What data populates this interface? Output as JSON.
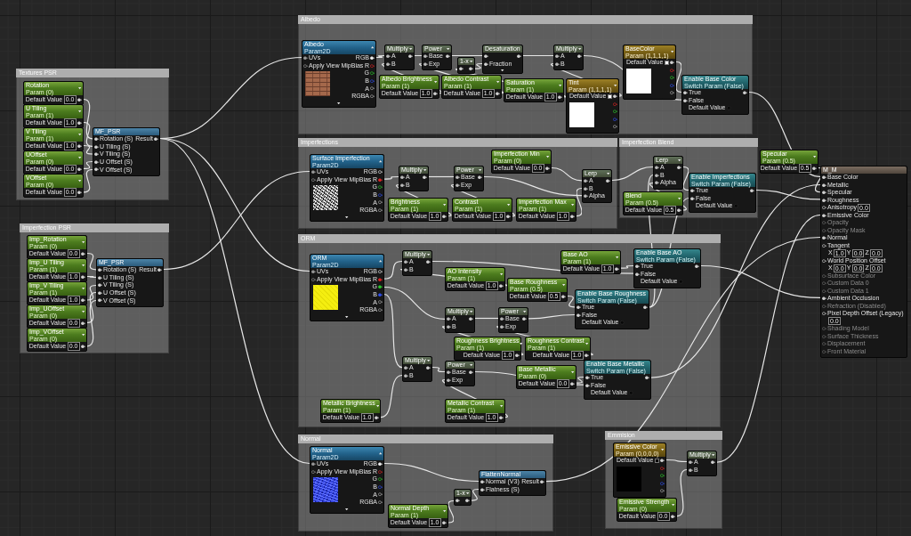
{
  "comment_boxes": [
    {
      "title": "Albedo",
      "nodes": [
        {
          "kind": "texture",
          "title": "Albedo",
          "subtitle": "Param2D",
          "inputs": [
            "UVs",
            "Apply View MipBias"
          ],
          "outputs": [
            "RGB",
            "R",
            "G",
            "B",
            "A",
            "RGBA"
          ]
        },
        {
          "kind": "math",
          "title": "Multiply",
          "inputs": [
            "A",
            "B"
          ]
        },
        {
          "kind": "scalar_param",
          "title": "Albedo Brightness",
          "subtitle": "Param (1)",
          "label": "Default Value",
          "value": "1.0"
        },
        {
          "kind": "math",
          "title": "Power",
          "inputs": [
            "Base",
            "Exp"
          ]
        },
        {
          "kind": "scalar_param",
          "title": "Albedo Contrast",
          "subtitle": "Param (1)",
          "label": "Default Value",
          "value": "1.0"
        },
        {
          "kind": "one_minus",
          "title": "1-x"
        },
        {
          "kind": "desaturation",
          "title": "Desaturation",
          "inputs": [
            "Fraction"
          ]
        },
        {
          "kind": "scalar_param",
          "title": "Saturation",
          "subtitle": "Param (1)",
          "label": "Default Value",
          "value": "1.0"
        },
        {
          "kind": "math",
          "title": "Multiply",
          "inputs": [
            "A",
            "B"
          ]
        },
        {
          "kind": "vector_param",
          "title": "Tint",
          "subtitle": "Param (1,1,1,1)",
          "label": "Default Value",
          "color": "#ffffff"
        },
        {
          "kind": "vector_param",
          "title": "BaseColor",
          "subtitle": "Param (1,1,1,1)",
          "label": "Default Value",
          "color": "#ffffff"
        },
        {
          "kind": "switch",
          "title": "Enable Base Color",
          "subtitle": "Switch Param (False)",
          "inputs": [
            "True",
            "False"
          ],
          "label": "Default Value",
          "checked": false
        }
      ]
    },
    {
      "title": "Textures PSR",
      "nodes": [
        {
          "kind": "scalar_param",
          "title": "Rotation",
          "subtitle": "Param (0)",
          "label": "Default Value",
          "value": "0.0"
        },
        {
          "kind": "scalar_param",
          "title": "U Tiling",
          "subtitle": "Param (1)",
          "label": "Default Value",
          "value": "1.0"
        },
        {
          "kind": "scalar_param",
          "title": "V Tiling",
          "subtitle": "Param (1)",
          "label": "Default Value",
          "value": "1.0"
        },
        {
          "kind": "scalar_param",
          "title": "UOffset",
          "subtitle": "Param (0)",
          "label": "Default Value",
          "value": "0.0"
        },
        {
          "kind": "scalar_param",
          "title": "VOffset",
          "subtitle": "Param (0)",
          "label": "Default Value",
          "value": "0.0"
        },
        {
          "kind": "function",
          "title": "MF_PSR",
          "inputs": [
            "Rotation (S)",
            "U Tiling (S)",
            "V Tiling (S)",
            "U Offset (S)",
            "V Offset (S)"
          ],
          "outputs": [
            "Result"
          ]
        }
      ]
    },
    {
      "title": "Imperfections",
      "nodes": [
        {
          "kind": "texture",
          "title": "Surface Imperfection",
          "subtitle": "Param2D",
          "inputs": [
            "UVs",
            "Apply View MipBias"
          ],
          "outputs": [
            "RGB",
            "R",
            "G",
            "B",
            "A",
            "RGBA"
          ]
        },
        {
          "kind": "math",
          "title": "Multiply",
          "inputs": [
            "A",
            "B"
          ]
        },
        {
          "kind": "scalar_param",
          "title": "Brightness",
          "subtitle": "Param (1)",
          "label": "Default Value",
          "value": "1.0"
        },
        {
          "kind": "math",
          "title": "Power",
          "inputs": [
            "Base",
            "Exp"
          ]
        },
        {
          "kind": "scalar_param",
          "title": "Contrast",
          "subtitle": "Param (1)",
          "label": "Default Value",
          "value": "1.0"
        },
        {
          "kind": "scalar_param",
          "title": "Imperfection Min",
          "subtitle": "Param (0)",
          "label": "Default Value",
          "value": "0.0"
        },
        {
          "kind": "scalar_param",
          "title": "Imperfection Max",
          "subtitle": "Param (1)",
          "label": "Default Value",
          "value": "1.0"
        },
        {
          "kind": "math",
          "title": "Lerp",
          "inputs": [
            "A",
            "B",
            "Alpha"
          ]
        }
      ]
    },
    {
      "title": "Imperfection Blend",
      "nodes": [
        {
          "kind": "math",
          "title": "Lerp",
          "inputs": [
            "A",
            "B",
            "Alpha"
          ]
        },
        {
          "kind": "scalar_param",
          "title": "Blend",
          "subtitle": "Param (0.5)",
          "label": "Default Value",
          "value": "0.5"
        },
        {
          "kind": "switch",
          "title": "Enable Imperfections",
          "subtitle": "Switch Param (False)",
          "inputs": [
            "True",
            "False"
          ],
          "label": "Default Value",
          "checked": false
        }
      ]
    },
    {
      "title": "Imperfection PSR",
      "nodes": [
        {
          "kind": "scalar_param",
          "title": "Imp_Rotation",
          "subtitle": "Param (0)",
          "label": "Default Value",
          "value": "0.0"
        },
        {
          "kind": "scalar_param",
          "title": "Imp_U Tiling",
          "subtitle": "Param (1)",
          "label": "Default Value",
          "value": "1.0"
        },
        {
          "kind": "scalar_param",
          "title": "Imp_V Tiling",
          "subtitle": "Param (1)",
          "label": "Default Value",
          "value": "1.0"
        },
        {
          "kind": "scalar_param",
          "title": "Imp_UOffset",
          "subtitle": "Param (0)",
          "label": "Default Value",
          "value": "0.0"
        },
        {
          "kind": "scalar_param",
          "title": "Imp_VOffset",
          "subtitle": "Param (0)",
          "label": "Default Value",
          "value": "0.0"
        },
        {
          "kind": "function",
          "title": "MF_PSR",
          "inputs": [
            "Rotation (S)",
            "U Tiling (S)",
            "V Tiling (S)",
            "U Offset (S)",
            "V Offset (S)"
          ],
          "outputs": [
            "Result"
          ]
        }
      ]
    },
    {
      "title": "ORM",
      "nodes": [
        {
          "kind": "texture",
          "title": "ORM",
          "subtitle": "Param2D",
          "inputs": [
            "UVs",
            "Apply View MipBias"
          ],
          "outputs": [
            "RGB",
            "R",
            "G",
            "B",
            "A",
            "RGBA"
          ]
        },
        {
          "kind": "math",
          "title": "Multiply",
          "inputs": [
            "A",
            "B"
          ]
        },
        {
          "kind": "scalar_param",
          "title": "AO Intensity",
          "subtitle": "Param (1)",
          "label": "Default Value",
          "value": "1.0"
        },
        {
          "kind": "scalar_param",
          "title": "Base Roughness",
          "subtitle": "Param (0.5)",
          "label": "Default Value",
          "value": "0.5"
        },
        {
          "kind": "scalar_param",
          "title": "Base AO",
          "subtitle": "Param (1)",
          "label": "Default Value",
          "value": "1.0"
        },
        {
          "kind": "switch",
          "title": "Enable Base AO",
          "subtitle": "Switch Param (False)",
          "inputs": [
            "True",
            "False"
          ],
          "label": "Default Value",
          "checked": false
        },
        {
          "kind": "math",
          "title": "Multiply",
          "inputs": [
            "A",
            "B"
          ]
        },
        {
          "kind": "math",
          "title": "Power",
          "inputs": [
            "Base",
            "Exp"
          ]
        },
        {
          "kind": "switch",
          "title": "Enable Base Roughness",
          "subtitle": "Switch Param (False)",
          "inputs": [
            "True",
            "False"
          ],
          "label": "Default Value",
          "checked": false
        },
        {
          "kind": "scalar_param",
          "title": "Roughness Brightness",
          "subtitle": "Param (1)",
          "label": "Default Value",
          "value": "1.0"
        },
        {
          "kind": "scalar_param",
          "title": "Roughness Contrast",
          "subtitle": "Param (1)",
          "label": "Default Value",
          "value": "1.0"
        },
        {
          "kind": "math",
          "title": "Multiply",
          "inputs": [
            "A",
            "B"
          ]
        },
        {
          "kind": "math",
          "title": "Power",
          "inputs": [
            "Base",
            "Exp"
          ]
        },
        {
          "kind": "scalar_param",
          "title": "Base Metallic",
          "subtitle": "Param (0)",
          "label": "Default Value",
          "value": "0.0"
        },
        {
          "kind": "switch",
          "title": "Enable Base Metallic",
          "subtitle": "Switch Param (False)",
          "inputs": [
            "True",
            "False"
          ],
          "label": "Default Value",
          "checked": false
        },
        {
          "kind": "scalar_param",
          "title": "Metallic Brightness",
          "subtitle": "Param (1)",
          "label": "Default Value",
          "value": "1.0"
        },
        {
          "kind": "scalar_param",
          "title": "Metallic Contrast",
          "subtitle": "Param (1)",
          "label": "Default Value",
          "value": "1.0"
        }
      ]
    },
    {
      "title": "Normal",
      "nodes": [
        {
          "kind": "texture",
          "title": "Normal",
          "subtitle": "Param2D",
          "inputs": [
            "UVs",
            "Apply View MipBias"
          ],
          "outputs": [
            "RGB",
            "R",
            "G",
            "B",
            "A",
            "RGBA"
          ]
        },
        {
          "kind": "scalar_param",
          "title": "Normal Depth",
          "subtitle": "Param (1)",
          "label": "Default Value",
          "value": "1.0"
        },
        {
          "kind": "one_minus",
          "title": "1-x"
        },
        {
          "kind": "function",
          "title": "FlattenNormal",
          "inputs": [
            "Normal (V3)",
            "Flatness (S)"
          ],
          "outputs": [
            "Result"
          ]
        }
      ]
    },
    {
      "title": "Emmision",
      "nodes": [
        {
          "kind": "vector_param",
          "title": "Emissive Color",
          "subtitle": "Param (0,0,0,0)",
          "label": "Default Value",
          "color": "#000000"
        },
        {
          "kind": "scalar_param",
          "title": "Emissive Strength",
          "subtitle": "Param (0)",
          "label": "Default Value",
          "value": "0.0"
        },
        {
          "kind": "math",
          "title": "Multiply",
          "inputs": [
            "A",
            "B"
          ]
        }
      ]
    }
  ],
  "nodes": [
    {
      "kind": "scalar_param",
      "title": "Specular",
      "subtitle": "Param (0.5)",
      "label": "Default Value",
      "value": "0.5"
    },
    {
      "kind": "material_result",
      "title": "M_M",
      "pins": [
        {
          "label": "Base Color",
          "kind": "plain",
          "disabled": false
        },
        {
          "label": "Metallic",
          "kind": "plain",
          "disabled": false
        },
        {
          "label": "Specular",
          "kind": "plain",
          "disabled": false
        },
        {
          "label": "Roughness",
          "kind": "plain",
          "disabled": false
        },
        {
          "label": "Anisotropy",
          "kind": "scalar",
          "value": "0.0",
          "disabled": false
        },
        {
          "label": "Emissive Color",
          "kind": "plain",
          "disabled": false
        },
        {
          "label": "Opacity",
          "kind": "plain",
          "disabled": true
        },
        {
          "label": "Opacity Mask",
          "kind": "plain",
          "disabled": true
        },
        {
          "label": "Normal",
          "kind": "plain",
          "disabled": false
        },
        {
          "label": "Tangent",
          "kind": "vector",
          "fields": [
            {
              "axis": "X",
              "value": "1.0"
            },
            {
              "axis": "Y",
              "value": "0.0"
            },
            {
              "axis": "Z",
              "value": "0.0"
            }
          ],
          "disabled": false
        },
        {
          "label": "World Position Offset",
          "kind": "vector",
          "fields": [
            {
              "axis": "X",
              "value": "0.0"
            },
            {
              "axis": "Y",
              "value": "0.0"
            },
            {
              "axis": "Z",
              "value": "0.0"
            }
          ],
          "disabled": false
        },
        {
          "label": "Subsurface Color",
          "kind": "plain",
          "disabled": true
        },
        {
          "label": "Custom Data 0",
          "kind": "plain",
          "disabled": true
        },
        {
          "label": "Custom Data 1",
          "kind": "plain",
          "disabled": true
        },
        {
          "label": "Ambient Occlusion",
          "kind": "plain",
          "disabled": false
        },
        {
          "label": "Refraction (Disabled)",
          "kind": "plain",
          "disabled": true
        },
        {
          "label": "Pixel Depth Offset (Legacy)",
          "kind": "scalar_below",
          "value": "0.0",
          "disabled": false
        },
        {
          "label": "Shading Model",
          "kind": "plain",
          "disabled": true
        },
        {
          "label": "Surface Thickness",
          "kind": "plain",
          "disabled": true
        },
        {
          "label": "Displacement",
          "kind": "plain",
          "disabled": true
        },
        {
          "label": "Front Material",
          "kind": "plain",
          "disabled": true
        }
      ]
    }
  ]
}
